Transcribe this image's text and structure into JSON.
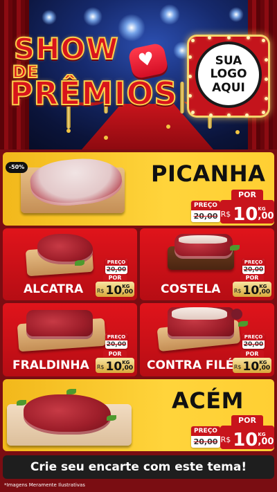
{
  "header": {
    "title_line1": "SHOW",
    "title_line2": "DE",
    "title_line3": "PRÊMIOS",
    "heart_icon": "heart-icon",
    "logo_placeholder": "SUA\nLOGO\nAQUI"
  },
  "featured": [
    {
      "name": "PICANHA",
      "badge": "-50%",
      "old_price_label": "PREÇO",
      "old_price": "20,00",
      "new_price_label": "POR",
      "currency": "R$",
      "price_int": "10",
      "price_cents": ",00",
      "unit": "KG"
    },
    {
      "name": "ACÉM",
      "old_price_label": "PREÇO",
      "old_price": "20,00",
      "new_price_label": "POR",
      "currency": "R$",
      "price_int": "10",
      "price_cents": ",00",
      "unit": "KG"
    }
  ],
  "products": [
    {
      "name": "ALCATRA",
      "old_price_label": "PREÇO",
      "old_price": "20,00",
      "new_price_label": "POR",
      "currency": "R$",
      "price_int": "10",
      "price_cents": ",00",
      "unit": "KG"
    },
    {
      "name": "COSTELA",
      "old_price_label": "PREÇO",
      "old_price": "20,00",
      "new_price_label": "POR",
      "currency": "R$",
      "price_int": "10",
      "price_cents": ",00",
      "unit": "KG"
    },
    {
      "name": "FRALDINHA",
      "old_price_label": "PREÇO",
      "old_price": "20,00",
      "new_price_label": "POR",
      "currency": "R$",
      "price_int": "10",
      "price_cents": ",00",
      "unit": "KG"
    },
    {
      "name": "CONTRA FILÉ",
      "old_price_label": "PREÇO",
      "old_price": "20,00",
      "new_price_label": "POR",
      "currency": "R$",
      "price_int": "10",
      "price_cents": ",00",
      "unit": "KG"
    }
  ],
  "footer": {
    "cta": "Crie seu encarte com este tema!",
    "disclaimer": "*Imagens Meramente Ilustrativas"
  },
  "colors": {
    "brand_red": "#c8141c",
    "brand_yellow": "#ffd43b",
    "gold": "#d9a93a"
  }
}
